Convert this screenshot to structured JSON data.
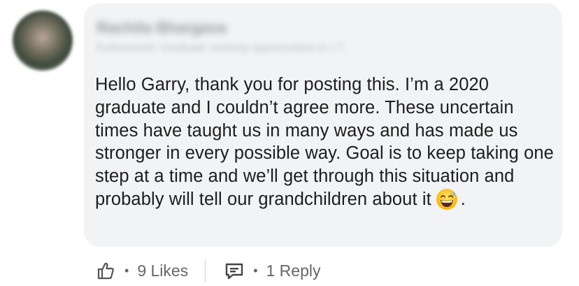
{
  "author": {
    "name": "Rachita Bhargava",
    "headline": "Enthusiastic Graduate seeking opportunities in I.T."
  },
  "comment": {
    "text": "Hello Garry, thank you for posting this. I’m a 2020 graduate and I couldn’t agree more. These uncertain times have taught us in many ways and has made us stronger in every possible way. Goal is to keep taking one step at a time and we’ll get through this situation and probably will tell our grandchildren about it",
    "ending": ".",
    "emoji": "grinning-face-with-sweat"
  },
  "actions": {
    "likes": "9 Likes",
    "separator": "•",
    "replies": "1 Reply"
  },
  "colors": {
    "bubble_bg": "#f2f3f5",
    "text": "#1d1d1d",
    "secondary_text": "#666666"
  },
  "icons": {
    "like": "thumbs-up-icon",
    "reply": "comment-icon"
  }
}
